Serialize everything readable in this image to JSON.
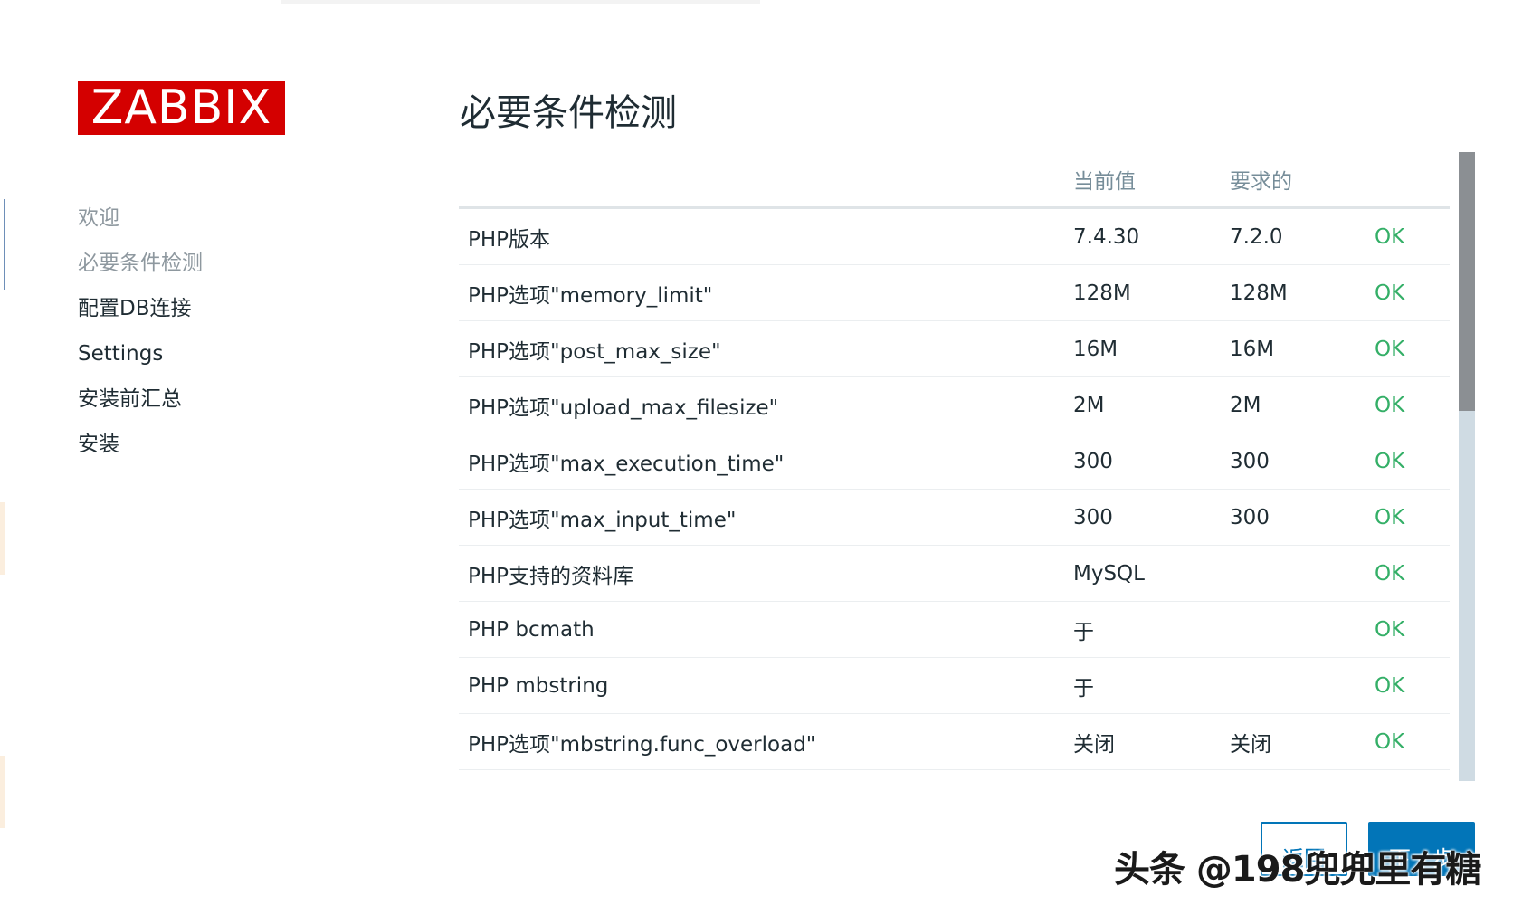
{
  "logo": {
    "text": "ZABBIX"
  },
  "sidebar": {
    "steps": [
      {
        "label": "欢迎",
        "state": "done"
      },
      {
        "label": "必要条件检测",
        "state": "current"
      },
      {
        "label": "配置DB连接",
        "state": "todo"
      },
      {
        "label": "Settings",
        "state": "todo"
      },
      {
        "label": "安装前汇总",
        "state": "todo"
      },
      {
        "label": "安装",
        "state": "todo"
      }
    ]
  },
  "main": {
    "title": "必要条件检测",
    "table": {
      "headers": [
        "",
        "当前值",
        "要求的",
        ""
      ],
      "rows": [
        {
          "name": "PHP版本",
          "current": "7.4.30",
          "required": "7.2.0",
          "status": "OK"
        },
        {
          "name": "PHP选项\"memory_limit\"",
          "current": "128M",
          "required": "128M",
          "status": "OK"
        },
        {
          "name": "PHP选项\"post_max_size\"",
          "current": "16M",
          "required": "16M",
          "status": "OK"
        },
        {
          "name": "PHP选项\"upload_max_filesize\"",
          "current": "2M",
          "required": "2M",
          "status": "OK"
        },
        {
          "name": "PHP选项\"max_execution_time\"",
          "current": "300",
          "required": "300",
          "status": "OK"
        },
        {
          "name": "PHP选项\"max_input_time\"",
          "current": "300",
          "required": "300",
          "status": "OK"
        },
        {
          "name": "PHP支持的资料库",
          "current": "MySQL",
          "required": "",
          "status": "OK"
        },
        {
          "name": "PHP bcmath",
          "current": "于",
          "required": "",
          "status": "OK"
        },
        {
          "name": "PHP mbstring",
          "current": "于",
          "required": "",
          "status": "OK"
        },
        {
          "name": "PHP选项\"mbstring.func_overload\"",
          "current": "关闭",
          "required": "关闭",
          "status": "OK"
        }
      ]
    }
  },
  "buttons": {
    "back": "返回",
    "next": "下一步"
  },
  "watermark": "头条 @198兜兜里有糖",
  "colors": {
    "brand": "#d40000",
    "ok": "#34af67",
    "primary": "#0275b8",
    "header_text": "#768d99"
  }
}
